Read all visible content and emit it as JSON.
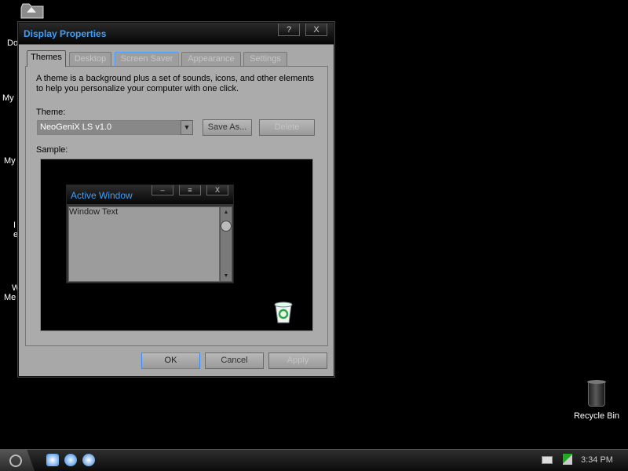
{
  "desktop": {
    "icon_labels": [
      {
        "text": "Do",
        "name": "desktop-icon-label-documents"
      },
      {
        "text": "My",
        "name": "desktop-icon-label-my-1"
      },
      {
        "text": "My",
        "name": "desktop-icon-label-my-2"
      },
      {
        "text": "I",
        "name": "desktop-icon-label-i"
      },
      {
        "text": "e",
        "name": "desktop-icon-label-e"
      },
      {
        "text": "W",
        "name": "desktop-icon-label-w"
      },
      {
        "text": "Me",
        "name": "desktop-icon-label-me"
      }
    ],
    "recycle_bin_label": "Recycle Bin"
  },
  "window": {
    "title": "Display Properties",
    "help_label": "?",
    "close_label": "X",
    "tabs": [
      {
        "label": "Themes",
        "active": true
      },
      {
        "label": "Desktop",
        "active": false
      },
      {
        "label": "Screen Saver",
        "active": false
      },
      {
        "label": "Appearance",
        "active": false
      },
      {
        "label": "Settings",
        "active": false
      }
    ],
    "description": "A theme is a background plus a set of sounds, icons, and other elements to help you personalize your computer with one click.",
    "theme_label": "Theme:",
    "theme_value": "NeoGeniX LS v1.0",
    "save_as_label": "Save As...",
    "delete_label": "Delete",
    "sample_label": "Sample:",
    "sample": {
      "title": "Active Window",
      "minimize": "–",
      "maximize": "≡",
      "close": "X",
      "body_text": "Window Text"
    },
    "ok_label": "OK",
    "cancel_label": "Cancel",
    "apply_label": "Apply"
  },
  "taskbar": {
    "clock": "3:34 PM"
  },
  "colors": {
    "accent": "#3ba0ff",
    "window_bg": "#a8a8a8",
    "desktop_bg": "#000000"
  }
}
